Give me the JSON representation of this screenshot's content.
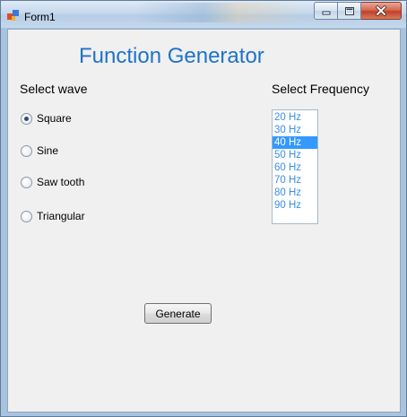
{
  "window": {
    "title": "Form1",
    "minimize_icon": "minimize-icon",
    "maximize_icon": "maximize-icon",
    "close_icon": "close-icon",
    "app_icon": "form-icon"
  },
  "form": {
    "heading": "Function Generator",
    "wave_label": "Select wave",
    "frequency_label": "Select Frequency",
    "waves": [
      {
        "label": "Square",
        "checked": true
      },
      {
        "label": "Sine",
        "checked": false
      },
      {
        "label": "Saw tooth",
        "checked": false
      },
      {
        "label": "Triangular",
        "checked": false
      }
    ],
    "frequencies": [
      "20 Hz",
      "30 Hz",
      "40 Hz",
      "50 Hz",
      "60 Hz",
      "70 Hz",
      "80 Hz",
      "90 Hz"
    ],
    "selected_frequency": "40 Hz",
    "generate_label": "Generate"
  },
  "colors": {
    "heading": "#1e73c8",
    "list_text": "#3b8fe0",
    "selection": "#3399ff",
    "client_bg": "#f0f0f0"
  }
}
